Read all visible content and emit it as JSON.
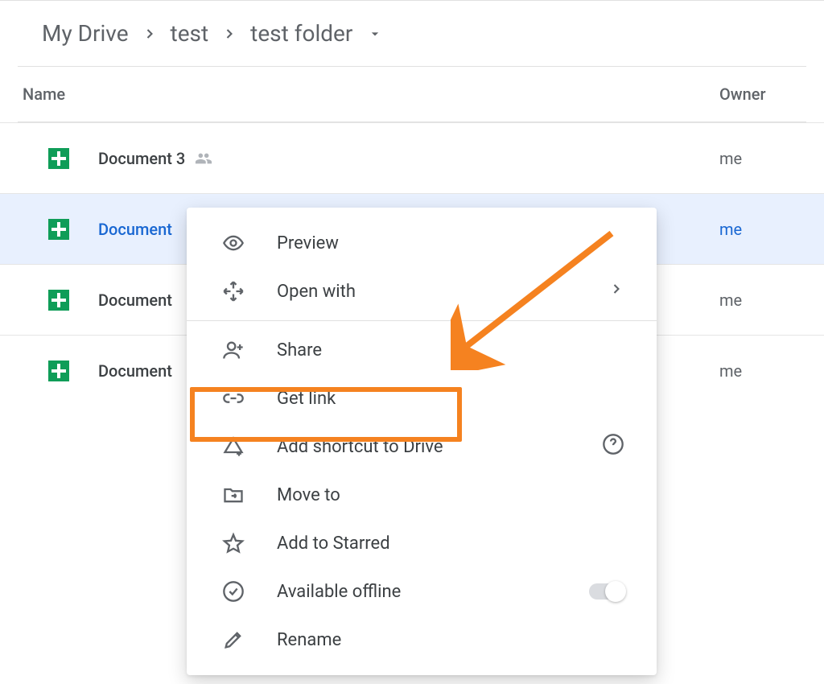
{
  "breadcrumb": {
    "root": "My Drive",
    "mid": "test",
    "leaf": "test folder"
  },
  "columns": {
    "name": "Name",
    "owner": "Owner"
  },
  "files": [
    {
      "name": "Document 3",
      "owner": "me"
    },
    {
      "name": "Document",
      "owner": "me"
    },
    {
      "name": "Document",
      "owner": "me"
    },
    {
      "name": "Document",
      "owner": "me"
    }
  ],
  "menu": {
    "preview": "Preview",
    "open_with": "Open with",
    "share": "Share",
    "get_link": "Get link",
    "add_shortcut": "Add shortcut to Drive",
    "move_to": "Move to",
    "add_starred": "Add to Starred",
    "available_offline": "Available offline",
    "rename": "Rename"
  }
}
